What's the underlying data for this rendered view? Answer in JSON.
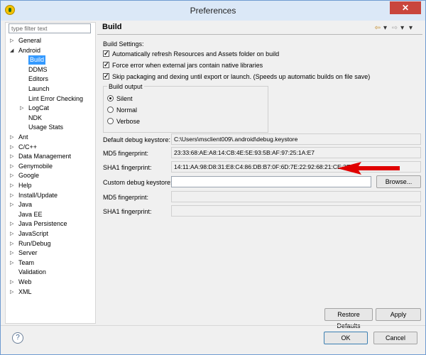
{
  "window": {
    "title": "Preferences"
  },
  "sidebar": {
    "filter_placeholder": "type filter text",
    "items": [
      {
        "label": "General",
        "twisty": "▷"
      },
      {
        "label": "Android",
        "twisty": "◢"
      },
      {
        "label": "Build",
        "selected": true
      },
      {
        "label": "DDMS"
      },
      {
        "label": "Editors"
      },
      {
        "label": "Launch"
      },
      {
        "label": "Lint Error Checking"
      },
      {
        "label": "LogCat",
        "twisty": "▷"
      },
      {
        "label": "NDK"
      },
      {
        "label": "Usage Stats"
      },
      {
        "label": "Ant",
        "twisty": "▷"
      },
      {
        "label": "C/C++",
        "twisty": "▷"
      },
      {
        "label": "Data Management",
        "twisty": "▷"
      },
      {
        "label": "Genymobile",
        "twisty": "▷"
      },
      {
        "label": "Google",
        "twisty": "▷"
      },
      {
        "label": "Help",
        "twisty": "▷"
      },
      {
        "label": "Install/Update",
        "twisty": "▷"
      },
      {
        "label": "Java",
        "twisty": "▷"
      },
      {
        "label": "Java EE"
      },
      {
        "label": "Java Persistence",
        "twisty": "▷"
      },
      {
        "label": "JavaScript",
        "twisty": "▷"
      },
      {
        "label": "Run/Debug",
        "twisty": "▷"
      },
      {
        "label": "Server",
        "twisty": "▷"
      },
      {
        "label": "Team",
        "twisty": "▷"
      },
      {
        "label": "Validation"
      },
      {
        "label": "Web",
        "twisty": "▷"
      },
      {
        "label": "XML",
        "twisty": "▷"
      }
    ]
  },
  "content": {
    "title": "Build",
    "build_settings_label": "Build Settings:",
    "checkboxes": [
      {
        "label": "Automatically refresh Resources and Assets folder on build",
        "checked": true
      },
      {
        "label": "Force error when external jars contain native libraries",
        "checked": true
      },
      {
        "label": "Skip packaging and dexing until export or launch. (Speeds up automatic builds on file save)",
        "checked": true
      }
    ],
    "build_output": {
      "title": "Build output",
      "options": [
        {
          "label": "Silent",
          "checked": true
        },
        {
          "label": "Normal",
          "checked": false
        },
        {
          "label": "Verbose",
          "checked": false
        }
      ]
    },
    "default_keystore_label": "Default debug keystore:",
    "default_keystore_value": "C:\\Users\\msclient009\\.android\\debug.keystore",
    "md5_label": "MD5 fingerprint:",
    "md5_value": "23:33:68:AE:A8:14:CB:4E:5E:93:5B:AF:97:25:1A:E7",
    "sha1_label": "SHA1 fingerprint:",
    "sha1_value": "14:11:AA:98:D8:31:E8:C4:86:DB:B7:0F:6D:7E:22:92:68:21:CE:3E",
    "custom_keystore_label": "Custom debug keystore:",
    "custom_keystore_value": "",
    "custom_md5_label": "MD5 fingerprint:",
    "custom_md5_value": "",
    "custom_sha1_label": "SHA1 fingerprint:",
    "custom_sha1_value": "",
    "browse_label": "Browse...",
    "restore_defaults_label": "Restore Defaults",
    "apply_label": "Apply"
  },
  "footer": {
    "help_label": "?",
    "ok_label": "OK",
    "cancel_label": "Cancel"
  },
  "colors": {
    "selection": "#3399ff",
    "arrow": "#e00000",
    "close": "#c9463d"
  }
}
